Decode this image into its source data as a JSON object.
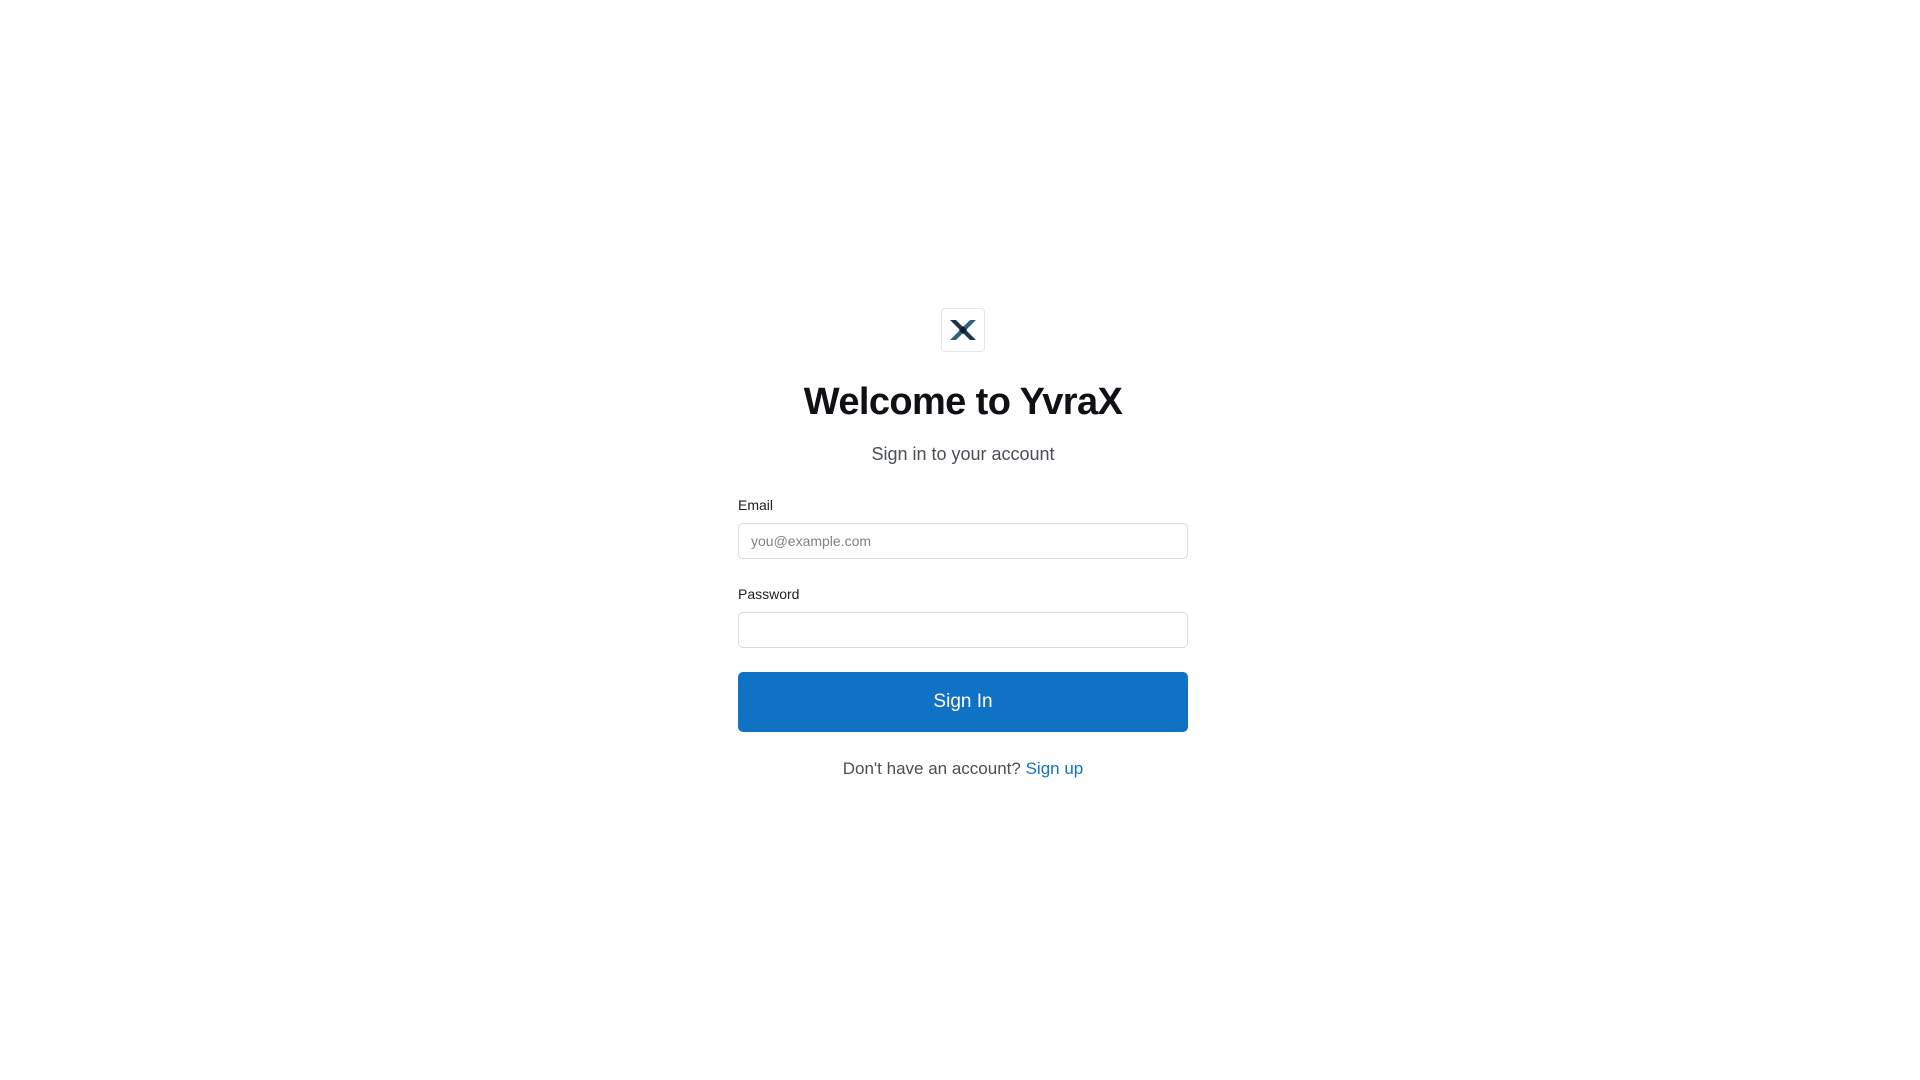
{
  "brand": {
    "logo_icon": "yvrax-x-logo-icon",
    "accent_color": "#1072c4"
  },
  "header": {
    "title": "Welcome to YvraX",
    "subtitle": "Sign in to your account"
  },
  "form": {
    "email": {
      "label": "Email",
      "placeholder": "you@example.com",
      "value": ""
    },
    "password": {
      "label": "Password",
      "placeholder": "",
      "value": ""
    },
    "submit_label": "Sign In"
  },
  "footer": {
    "prompt": "Don't have an account?",
    "link_label": "Sign up"
  }
}
